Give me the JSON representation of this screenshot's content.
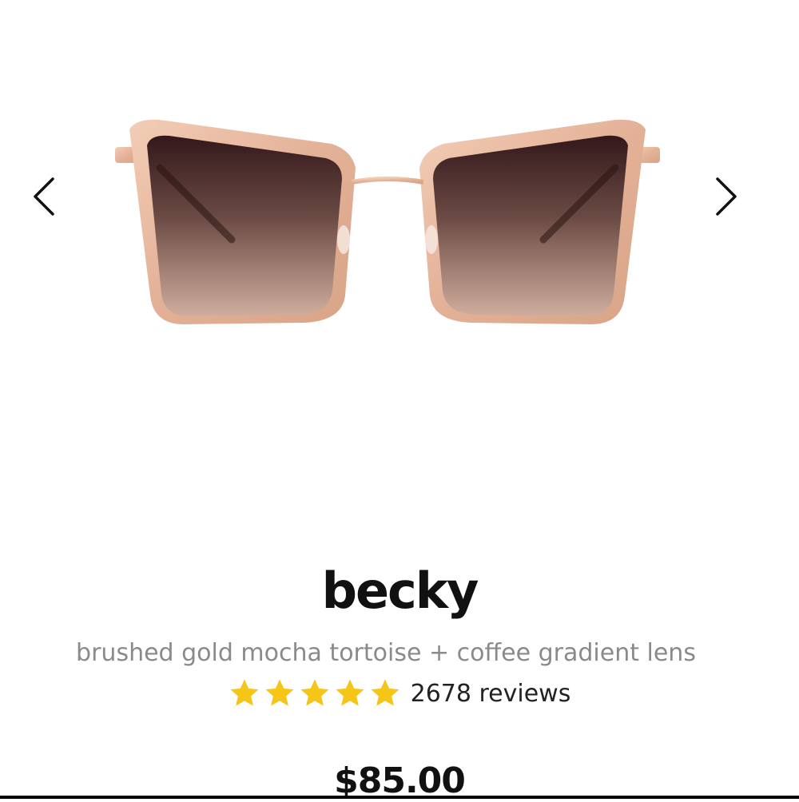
{
  "carousel": {
    "prev_icon": "chevron-left-icon",
    "next_icon": "chevron-right-icon",
    "image_alt": "sunglasses product image"
  },
  "product": {
    "name": "becky",
    "variant": "brushed gold mocha tortoise + coffee gradient lens",
    "rating": {
      "value": 5,
      "max": 5,
      "star_color": "#f5c518",
      "reviews_label": "2678 reviews"
    },
    "price": "$85.00"
  },
  "colors": {
    "frame_gold": "#e7b9a0",
    "lens_top": "#3a1c1c",
    "lens_bottom": "#c9a796"
  }
}
